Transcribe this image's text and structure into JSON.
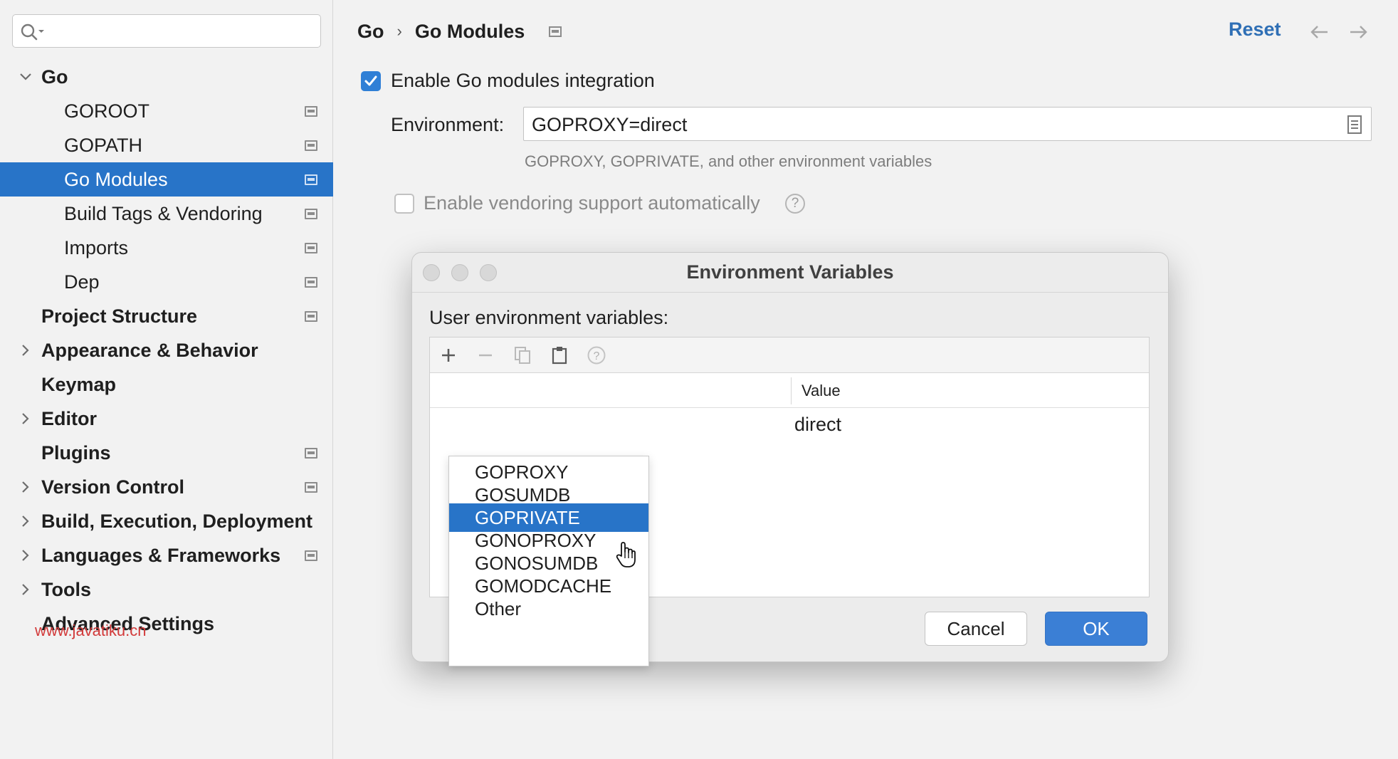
{
  "sidebar": {
    "search_value": "",
    "items": [
      {
        "label": "Go",
        "expanded": true
      },
      {
        "label": "GOROOT"
      },
      {
        "label": "GOPATH"
      },
      {
        "label": "Go Modules",
        "selected": true
      },
      {
        "label": "Build Tags & Vendoring"
      },
      {
        "label": "Imports"
      },
      {
        "label": "Dep"
      },
      {
        "label": "Project Structure"
      },
      {
        "label": "Appearance & Behavior"
      },
      {
        "label": "Keymap"
      },
      {
        "label": "Editor"
      },
      {
        "label": "Plugins"
      },
      {
        "label": "Version Control"
      },
      {
        "label": "Build, Execution, Deployment"
      },
      {
        "label": "Languages & Frameworks"
      },
      {
        "label": "Tools"
      },
      {
        "label": "Advanced Settings"
      }
    ],
    "watermark": "www.javatiku.cn"
  },
  "header": {
    "breadcrumb_parent": "Go",
    "breadcrumb_separator": "›",
    "breadcrumb_current": "Go Modules",
    "reset_label": "Reset"
  },
  "settings": {
    "enable_modules_label": "Enable Go modules integration",
    "enable_modules_checked": true,
    "environment_label": "Environment:",
    "environment_value": "GOPROXY=direct",
    "environment_hint": "GOPROXY, GOPRIVATE, and other environment variables",
    "vendoring_label": "Enable vendoring support automatically",
    "vendoring_checked": false,
    "help_glyph": "?"
  },
  "dialog": {
    "title": "Environment Variables",
    "user_vars_label": "User environment variables:",
    "column_value": "Value",
    "row_value": "direct",
    "help_glyph": "?",
    "dropdown_items": [
      "GOPROXY",
      "GOSUMDB",
      "GOPRIVATE",
      "GONOPROXY",
      "GONOSUMDB",
      "GOMODCACHE",
      "Other"
    ],
    "dropdown_selected": "GOPRIVATE",
    "cancel_label": "Cancel",
    "ok_label": "OK"
  },
  "colors": {
    "selection": "#2874c8",
    "link": "#2f6fb5",
    "checkbox": "#2f7fd6",
    "ok_button": "#3b7fd5"
  },
  "icons": {
    "search": "search-icon",
    "chevron_down": "chevron-down-icon",
    "chevron_right": "chevron-right-icon",
    "project_level": "project-level-icon",
    "back": "arrow-left-icon",
    "forward": "arrow-right-icon",
    "browse": "browse-icon",
    "add": "plus-icon",
    "remove": "minus-icon",
    "copy": "copy-icon",
    "paste": "paste-icon",
    "help": "help-icon",
    "cursor": "hand-cursor-icon"
  }
}
